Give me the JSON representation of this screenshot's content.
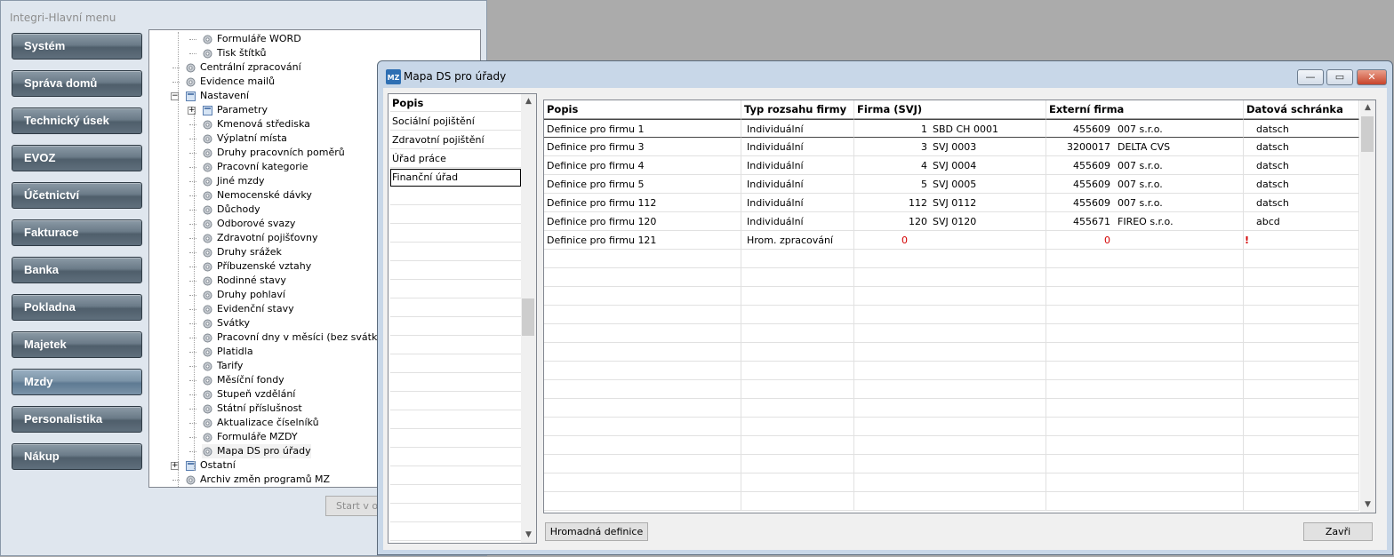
{
  "main_window": {
    "title": "Integri-Hlavní menu",
    "nav_buttons": [
      {
        "label": "Systém"
      },
      {
        "label": "Správa domů"
      },
      {
        "label": "Technický úsek"
      },
      {
        "label": "EVOZ"
      },
      {
        "label": "Účetnictví"
      },
      {
        "label": "Fakturace"
      },
      {
        "label": "Banka"
      },
      {
        "label": "Pokladna"
      },
      {
        "label": "Majetek"
      },
      {
        "label": "Mzdy"
      },
      {
        "label": "Personalistika"
      },
      {
        "label": "Nákup"
      }
    ],
    "tree": [
      {
        "label": "Formuláře WORD",
        "level": 2
      },
      {
        "label": "Tisk štítků",
        "level": 2
      },
      {
        "label": "Centrální zpracování",
        "level": 1
      },
      {
        "label": "Evidence mailů",
        "level": 1
      },
      {
        "label": "Nastavení",
        "level": 1,
        "expander": "−",
        "folder": true
      },
      {
        "label": "Parametry",
        "level": 2,
        "expander": "+",
        "folder": true
      },
      {
        "label": "Kmenová střediska",
        "level": 2
      },
      {
        "label": "Výplatní místa",
        "level": 2
      },
      {
        "label": "Druhy pracovních poměrů",
        "level": 2
      },
      {
        "label": "Pracovní kategorie",
        "level": 2
      },
      {
        "label": "Jiné mzdy",
        "level": 2
      },
      {
        "label": "Nemocenské dávky",
        "level": 2
      },
      {
        "label": "Důchody",
        "level": 2
      },
      {
        "label": "Odborové svazy",
        "level": 2
      },
      {
        "label": "Zdravotní pojišťovny",
        "level": 2
      },
      {
        "label": "Druhy srážek",
        "level": 2
      },
      {
        "label": "Příbuzenské vztahy",
        "level": 2
      },
      {
        "label": "Rodinné stavy",
        "level": 2
      },
      {
        "label": "Druhy pohlaví",
        "level": 2
      },
      {
        "label": "Evidenční stavy",
        "level": 2
      },
      {
        "label": "Svátky",
        "level": 2
      },
      {
        "label": "Pracovní dny v měsíci (bez svátků)",
        "level": 2
      },
      {
        "label": "Platidla",
        "level": 2
      },
      {
        "label": "Tarify",
        "level": 2
      },
      {
        "label": "Měsíční fondy",
        "level": 2
      },
      {
        "label": "Stupeň vzdělání",
        "level": 2
      },
      {
        "label": "Státní příslušnost",
        "level": 2
      },
      {
        "label": "Aktualizace číselníků",
        "level": 2
      },
      {
        "label": "Formuláře MZDY",
        "level": 2
      },
      {
        "label": "Mapa DS pro úřady",
        "level": 2,
        "selected": true
      },
      {
        "label": "Ostatní",
        "level": 1,
        "expander": "+",
        "folder": true
      },
      {
        "label": "Archiv změn programů MZ",
        "level": 1
      }
    ],
    "start_button": "Start v ok"
  },
  "dialog": {
    "title": "Mapa DS pro úřady",
    "icon_text": "MZ",
    "left_list": {
      "header": "Popis",
      "items": [
        "Sociální pojištění",
        "Zdravotní pojištění",
        "Úřad práce",
        "Finanční úřad"
      ],
      "selected_index": 3
    },
    "grid": {
      "columns": [
        "Popis",
        "Typ rozsahu firmy",
        "Firma (SVJ)",
        "Externí firma",
        "Datová schránka"
      ],
      "rows": [
        {
          "popis": "Definice pro firmu 1",
          "typ": "Individuální",
          "firma_num": "1",
          "firma_name": "SBD CH 0001",
          "ext_num": "455609",
          "ext_name": "007 s.r.o.",
          "ds": "datsch"
        },
        {
          "popis": "Definice pro firmu 3",
          "typ": "Individuální",
          "firma_num": "3",
          "firma_name": "SVJ 0003",
          "ext_num": "3200017",
          "ext_name": "DELTA CVS",
          "ds": "datsch"
        },
        {
          "popis": "Definice pro firmu 4",
          "typ": "Individuální",
          "firma_num": "4",
          "firma_name": "SVJ 0004",
          "ext_num": "455609",
          "ext_name": "007 s.r.o.",
          "ds": "datsch"
        },
        {
          "popis": "Definice pro firmu 5",
          "typ": "Individuální",
          "firma_num": "5",
          "firma_name": "SVJ 0005",
          "ext_num": "455609",
          "ext_name": "007 s.r.o.",
          "ds": "datsch"
        },
        {
          "popis": "Definice pro firmu 112",
          "typ": "Individuální",
          "firma_num": "112",
          "firma_name": "SVJ 0112",
          "ext_num": "455609",
          "ext_name": "007 s.r.o.",
          "ds": "datsch"
        },
        {
          "popis": "Definice pro firmu 120",
          "typ": "Individuální",
          "firma_num": "120",
          "firma_name": "SVJ 0120",
          "ext_num": "455671",
          "ext_name": "FIREO  s.r.o.",
          "ds": "abcd"
        },
        {
          "popis": "Definice pro firmu 121",
          "typ": "Hrom. zpracování",
          "firma_num": "0",
          "firma_name": "",
          "ext_num": "0",
          "ext_name": "",
          "ds": "!",
          "error": true
        }
      ]
    },
    "buttons": {
      "bulk": "Hromadná definice",
      "close": "Zavři"
    }
  },
  "colors": {
    "error": "#d40000",
    "nav_button": "#5f6f7c"
  }
}
